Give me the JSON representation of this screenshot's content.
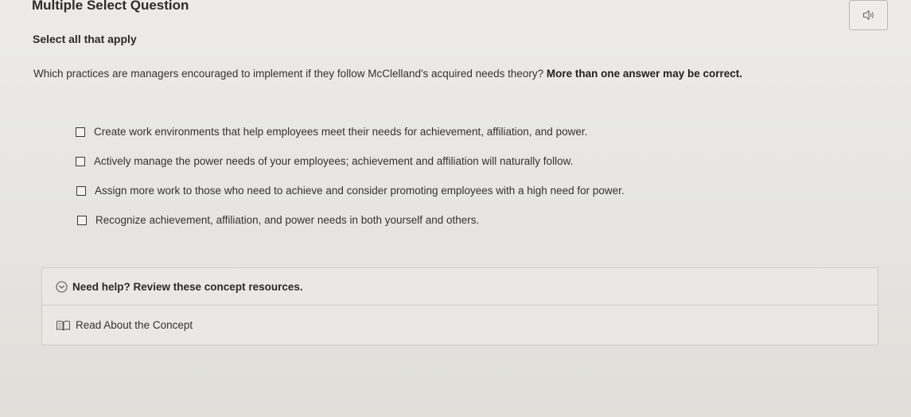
{
  "question": {
    "type_label": "Multiple Select Question",
    "instruction": "Select all that apply",
    "prompt_text": "Which practices are managers encouraged to implement if they follow McClelland's acquired needs theory? ",
    "prompt_emphasis": "More than one answer may be correct.",
    "audio_icon": "speaker-icon",
    "options": [
      {
        "label": "Create work environments that help employees meet their needs for achievement, affiliation, and power.",
        "checked": false
      },
      {
        "label": "Actively manage the power needs of your employees; achievement and affiliation will naturally follow.",
        "checked": false
      },
      {
        "label": "Assign more work to those who need to achieve and consider promoting employees with a high need for power.",
        "checked": false
      },
      {
        "label": "Recognize achievement, affiliation, and power needs in both yourself and others.",
        "checked": false
      }
    ]
  },
  "help": {
    "header_label": "Need help? Review these concept resources.",
    "header_icon": "chevron-down-circle-icon",
    "link_label": "Read About the Concept",
    "link_icon": "book-icon"
  }
}
